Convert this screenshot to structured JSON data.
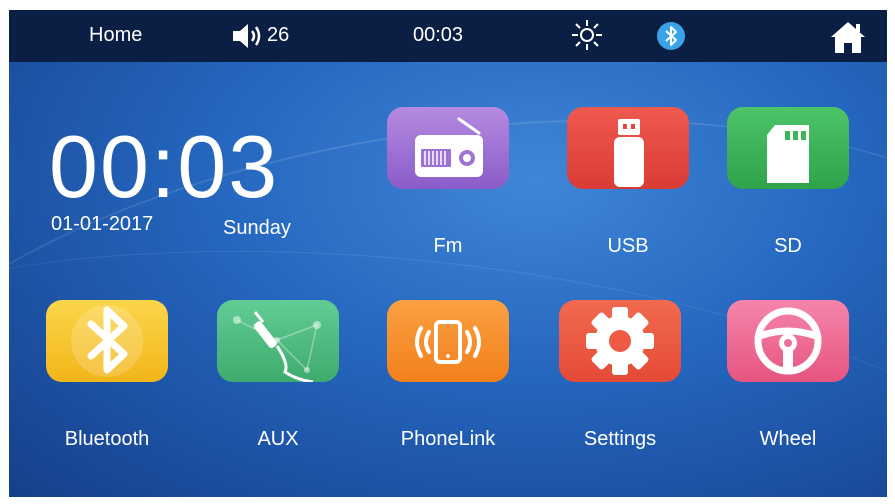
{
  "status_bar": {
    "home_label": "Home",
    "volume": "26",
    "time": "00:03",
    "brightness_icon": "sun-icon",
    "bluetooth_icon": "bluetooth-icon",
    "home_icon": "house-icon"
  },
  "clock": {
    "time": "00:03",
    "date": "01-01-2017",
    "day": "Sunday"
  },
  "apps": [
    {
      "label": "Fm",
      "icon": "radio-icon",
      "color": "#9b6fd2"
    },
    {
      "label": "USB",
      "icon": "usb-drive-icon",
      "color": "#e8453c"
    },
    {
      "label": "SD",
      "icon": "sd-card-icon",
      "color": "#3fb55a"
    },
    {
      "label": "Bluetooth",
      "icon": "bluetooth-icon",
      "color": "#f7c320"
    },
    {
      "label": "AUX",
      "icon": "aux-cable-icon",
      "color": "#4fbf82"
    },
    {
      "label": "PhoneLink",
      "icon": "phone-vibrate-icon",
      "color": "#f7932c"
    },
    {
      "label": "Settings",
      "icon": "gear-icon",
      "color": "#ee5a43"
    },
    {
      "label": "Wheel",
      "icon": "steering-wheel-icon",
      "color": "#ee6f98"
    }
  ]
}
